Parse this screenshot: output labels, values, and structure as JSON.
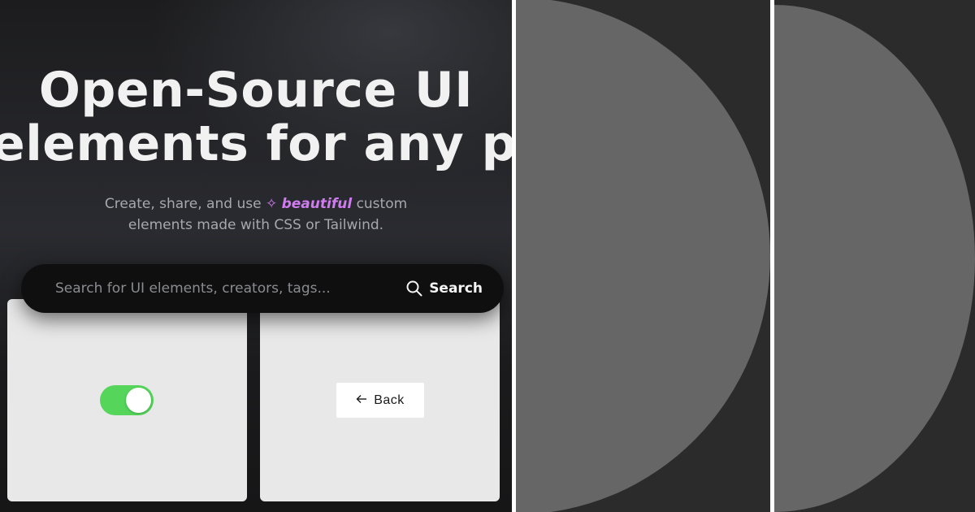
{
  "hero": {
    "title_line1": "Open-Source UI",
    "title_line2": "elements for any project",
    "subtitle_part1": "Create, share, and use",
    "sparkle_icon": "sparkles-icon",
    "subtitle_highlight": "beautiful",
    "subtitle_part2": "custom",
    "subtitle_line2": "elements made with CSS or Tailwind."
  },
  "search": {
    "placeholder": "Search for UI elements, creators, tags...",
    "button_label": "Search",
    "icon": "search-icon"
  },
  "cards": {
    "toggle": {
      "state": "on"
    },
    "back_button": {
      "label": "Back",
      "icon": "arrow-left-icon"
    }
  },
  "colors": {
    "hero_background": "#1c1c1e",
    "accent": "#d07bf0",
    "toggle_on": "#55d65b",
    "card_background": "#e8e8e8",
    "panel_background": "#2b2b2b",
    "panel_shape": "#666666"
  }
}
